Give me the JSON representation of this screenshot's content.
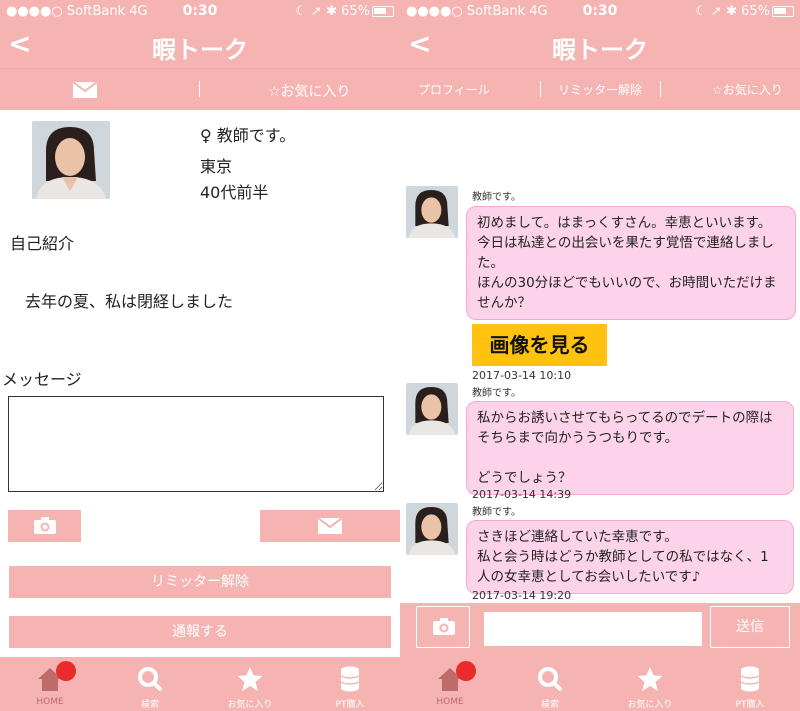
{
  "left": {
    "status": {
      "carrier": "●●●●○ SoftBank   4G",
      "time": "0:30",
      "right": "☾ ➚ ✱  65%"
    },
    "nav": {
      "back": "<",
      "title": "暇トーク"
    },
    "subbar": {
      "favorite": "☆お気に入り"
    },
    "profile": {
      "gender_occupation": "♀  教師です。",
      "location": "東京",
      "age": "40代前半",
      "intro_heading": "自己紹介",
      "intro_text": "去年の夏、私は閉経しました",
      "message_heading": "メッセージ",
      "limiter_button": "リミッター解除",
      "report_button": "通報する"
    }
  },
  "right": {
    "status": {
      "carrier": "●●●●○ SoftBank   4G",
      "time": "0:30",
      "right": "☾ ➚ ✱  65%"
    },
    "nav": {
      "back": "<",
      "title": "暇トーク"
    },
    "subbar": {
      "profile": "プロフィール",
      "limiter": "リミッター解除",
      "favorite": "☆お気に入り"
    },
    "messages": [
      {
        "sender": "教師です。",
        "lines": [
          "初めまして。はまっくすさん。幸恵といいます。",
          "今日は私達との出会いを果たす覚悟で連絡しまし",
          "た。",
          "ほんの30分ほどでもいいので、お時間いただけま",
          "せんか？"
        ],
        "time": "2017-03-14 10:10"
      },
      {
        "sender": "教師です。",
        "lines": [
          "私からお誘いさせてもらってるのでデートの際は",
          "そちらまで向かううつもりです。",
          "",
          "どうでしょう？"
        ],
        "time": "2017-03-14 14:39"
      },
      {
        "sender": "教師です。",
        "lines": [
          "さきほど連絡していた幸恵です。",
          "私と会う時はどうか教師としての私ではなく、1",
          "人の女幸恵としてお会いしたいです♪"
        ],
        "time": "2017-03-14 19:20"
      }
    ],
    "image_button": "画像を見る",
    "send_button": "送信"
  },
  "tabs": [
    {
      "label": "HOME",
      "icon": "home-icon"
    },
    {
      "label": "検索",
      "icon": "search-icon"
    },
    {
      "label": "お気に入り",
      "icon": "star-icon"
    },
    {
      "label": "PT購入",
      "icon": "coins-icon"
    }
  ],
  "colors": {
    "brand_pink": "#f5b4b2",
    "bubble_pink": "#fdd3ea",
    "badge_red": "#ea2b2b",
    "image_button": "#ffc20e"
  }
}
